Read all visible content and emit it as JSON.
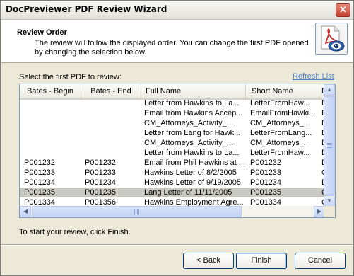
{
  "window": {
    "title": "DocPreviewer PDF Review Wizard",
    "close_glyph": "✕"
  },
  "header": {
    "title": "Review Order",
    "description": "The review will follow the displayed order.  You can change the first PDF opened by changing the selection below.",
    "icon": "pdf-eye-icon"
  },
  "select_label": "Select the first PDF to review:",
  "refresh_label": "Refresh List",
  "table": {
    "columns": [
      "Bates - Begin",
      "Bates - End",
      "Full Name",
      "Short Name",
      "D"
    ],
    "rows": [
      [
        "",
        "",
        "Letter from Hawkins to La...",
        "LetterFromHaw...",
        "D"
      ],
      [
        "",
        "",
        "Email from Hawkins Accep...",
        "EmailFromHawki...",
        "D"
      ],
      [
        "",
        "",
        "CM_Attorneys_Activity_...",
        "CM_Attorneys_...",
        "D"
      ],
      [
        "",
        "",
        "Letter from Lang for Hawk...",
        "LetterFromLang...",
        "D"
      ],
      [
        "",
        "",
        "CM_Attorneys_Activity_...",
        "CM_Attorneys_...",
        "D"
      ],
      [
        "",
        "",
        "Letter from Hawkins to La...",
        "LetterFromHaw...",
        "D"
      ],
      [
        "P001232",
        "P001232",
        "Email from Phil Hawkins at ...",
        "P001232",
        "D"
      ],
      [
        "P001233",
        "P001233",
        "Hawkins Letter of 8/2/2005",
        "P001233",
        "C"
      ],
      [
        "P001234",
        "P001234",
        "Hawkins Letter of 9/19/2005",
        "P001234",
        "D"
      ],
      [
        "P001235",
        "P001235",
        "Lang Letter of 11/11/2005",
        "P001235",
        "C"
      ],
      [
        "P001334",
        "P001356",
        "Hawkins Employment Agre...",
        "P001334",
        "C"
      ]
    ],
    "selected_row": 9
  },
  "scroll": {
    "up": "▲",
    "down": "▼",
    "left": "◀",
    "right": "▶"
  },
  "start_text": "To start your review, click Finish.",
  "buttons": {
    "back": "< Back",
    "finish": "Finish",
    "cancel": "Cancel"
  }
}
